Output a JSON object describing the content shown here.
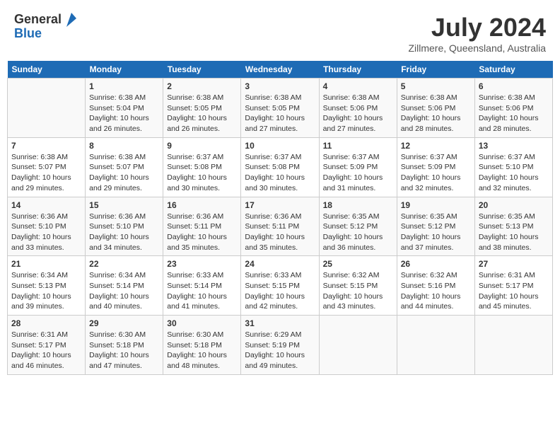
{
  "header": {
    "logo_general": "General",
    "logo_blue": "Blue",
    "month_title": "July 2024",
    "location": "Zillmere, Queensland, Australia"
  },
  "days_of_week": [
    "Sunday",
    "Monday",
    "Tuesday",
    "Wednesday",
    "Thursday",
    "Friday",
    "Saturday"
  ],
  "weeks": [
    [
      {
        "day": "",
        "sunrise": "",
        "sunset": "",
        "daylight": ""
      },
      {
        "day": "1",
        "sunrise": "Sunrise: 6:38 AM",
        "sunset": "Sunset: 5:04 PM",
        "daylight": "Daylight: 10 hours and 26 minutes."
      },
      {
        "day": "2",
        "sunrise": "Sunrise: 6:38 AM",
        "sunset": "Sunset: 5:05 PM",
        "daylight": "Daylight: 10 hours and 26 minutes."
      },
      {
        "day": "3",
        "sunrise": "Sunrise: 6:38 AM",
        "sunset": "Sunset: 5:05 PM",
        "daylight": "Daylight: 10 hours and 27 minutes."
      },
      {
        "day": "4",
        "sunrise": "Sunrise: 6:38 AM",
        "sunset": "Sunset: 5:06 PM",
        "daylight": "Daylight: 10 hours and 27 minutes."
      },
      {
        "day": "5",
        "sunrise": "Sunrise: 6:38 AM",
        "sunset": "Sunset: 5:06 PM",
        "daylight": "Daylight: 10 hours and 28 minutes."
      },
      {
        "day": "6",
        "sunrise": "Sunrise: 6:38 AM",
        "sunset": "Sunset: 5:06 PM",
        "daylight": "Daylight: 10 hours and 28 minutes."
      }
    ],
    [
      {
        "day": "7",
        "sunrise": "Sunrise: 6:38 AM",
        "sunset": "Sunset: 5:07 PM",
        "daylight": "Daylight: 10 hours and 29 minutes."
      },
      {
        "day": "8",
        "sunrise": "Sunrise: 6:38 AM",
        "sunset": "Sunset: 5:07 PM",
        "daylight": "Daylight: 10 hours and 29 minutes."
      },
      {
        "day": "9",
        "sunrise": "Sunrise: 6:37 AM",
        "sunset": "Sunset: 5:08 PM",
        "daylight": "Daylight: 10 hours and 30 minutes."
      },
      {
        "day": "10",
        "sunrise": "Sunrise: 6:37 AM",
        "sunset": "Sunset: 5:08 PM",
        "daylight": "Daylight: 10 hours and 30 minutes."
      },
      {
        "day": "11",
        "sunrise": "Sunrise: 6:37 AM",
        "sunset": "Sunset: 5:09 PM",
        "daylight": "Daylight: 10 hours and 31 minutes."
      },
      {
        "day": "12",
        "sunrise": "Sunrise: 6:37 AM",
        "sunset": "Sunset: 5:09 PM",
        "daylight": "Daylight: 10 hours and 32 minutes."
      },
      {
        "day": "13",
        "sunrise": "Sunrise: 6:37 AM",
        "sunset": "Sunset: 5:10 PM",
        "daylight": "Daylight: 10 hours and 32 minutes."
      }
    ],
    [
      {
        "day": "14",
        "sunrise": "Sunrise: 6:36 AM",
        "sunset": "Sunset: 5:10 PM",
        "daylight": "Daylight: 10 hours and 33 minutes."
      },
      {
        "day": "15",
        "sunrise": "Sunrise: 6:36 AM",
        "sunset": "Sunset: 5:10 PM",
        "daylight": "Daylight: 10 hours and 34 minutes."
      },
      {
        "day": "16",
        "sunrise": "Sunrise: 6:36 AM",
        "sunset": "Sunset: 5:11 PM",
        "daylight": "Daylight: 10 hours and 35 minutes."
      },
      {
        "day": "17",
        "sunrise": "Sunrise: 6:36 AM",
        "sunset": "Sunset: 5:11 PM",
        "daylight": "Daylight: 10 hours and 35 minutes."
      },
      {
        "day": "18",
        "sunrise": "Sunrise: 6:35 AM",
        "sunset": "Sunset: 5:12 PM",
        "daylight": "Daylight: 10 hours and 36 minutes."
      },
      {
        "day": "19",
        "sunrise": "Sunrise: 6:35 AM",
        "sunset": "Sunset: 5:12 PM",
        "daylight": "Daylight: 10 hours and 37 minutes."
      },
      {
        "day": "20",
        "sunrise": "Sunrise: 6:35 AM",
        "sunset": "Sunset: 5:13 PM",
        "daylight": "Daylight: 10 hours and 38 minutes."
      }
    ],
    [
      {
        "day": "21",
        "sunrise": "Sunrise: 6:34 AM",
        "sunset": "Sunset: 5:13 PM",
        "daylight": "Daylight: 10 hours and 39 minutes."
      },
      {
        "day": "22",
        "sunrise": "Sunrise: 6:34 AM",
        "sunset": "Sunset: 5:14 PM",
        "daylight": "Daylight: 10 hours and 40 minutes."
      },
      {
        "day": "23",
        "sunrise": "Sunrise: 6:33 AM",
        "sunset": "Sunset: 5:14 PM",
        "daylight": "Daylight: 10 hours and 41 minutes."
      },
      {
        "day": "24",
        "sunrise": "Sunrise: 6:33 AM",
        "sunset": "Sunset: 5:15 PM",
        "daylight": "Daylight: 10 hours and 42 minutes."
      },
      {
        "day": "25",
        "sunrise": "Sunrise: 6:32 AM",
        "sunset": "Sunset: 5:15 PM",
        "daylight": "Daylight: 10 hours and 43 minutes."
      },
      {
        "day": "26",
        "sunrise": "Sunrise: 6:32 AM",
        "sunset": "Sunset: 5:16 PM",
        "daylight": "Daylight: 10 hours and 44 minutes."
      },
      {
        "day": "27",
        "sunrise": "Sunrise: 6:31 AM",
        "sunset": "Sunset: 5:17 PM",
        "daylight": "Daylight: 10 hours and 45 minutes."
      }
    ],
    [
      {
        "day": "28",
        "sunrise": "Sunrise: 6:31 AM",
        "sunset": "Sunset: 5:17 PM",
        "daylight": "Daylight: 10 hours and 46 minutes."
      },
      {
        "day": "29",
        "sunrise": "Sunrise: 6:30 AM",
        "sunset": "Sunset: 5:18 PM",
        "daylight": "Daylight: 10 hours and 47 minutes."
      },
      {
        "day": "30",
        "sunrise": "Sunrise: 6:30 AM",
        "sunset": "Sunset: 5:18 PM",
        "daylight": "Daylight: 10 hours and 48 minutes."
      },
      {
        "day": "31",
        "sunrise": "Sunrise: 6:29 AM",
        "sunset": "Sunset: 5:19 PM",
        "daylight": "Daylight: 10 hours and 49 minutes."
      },
      {
        "day": "",
        "sunrise": "",
        "sunset": "",
        "daylight": ""
      },
      {
        "day": "",
        "sunrise": "",
        "sunset": "",
        "daylight": ""
      },
      {
        "day": "",
        "sunrise": "",
        "sunset": "",
        "daylight": ""
      }
    ]
  ]
}
